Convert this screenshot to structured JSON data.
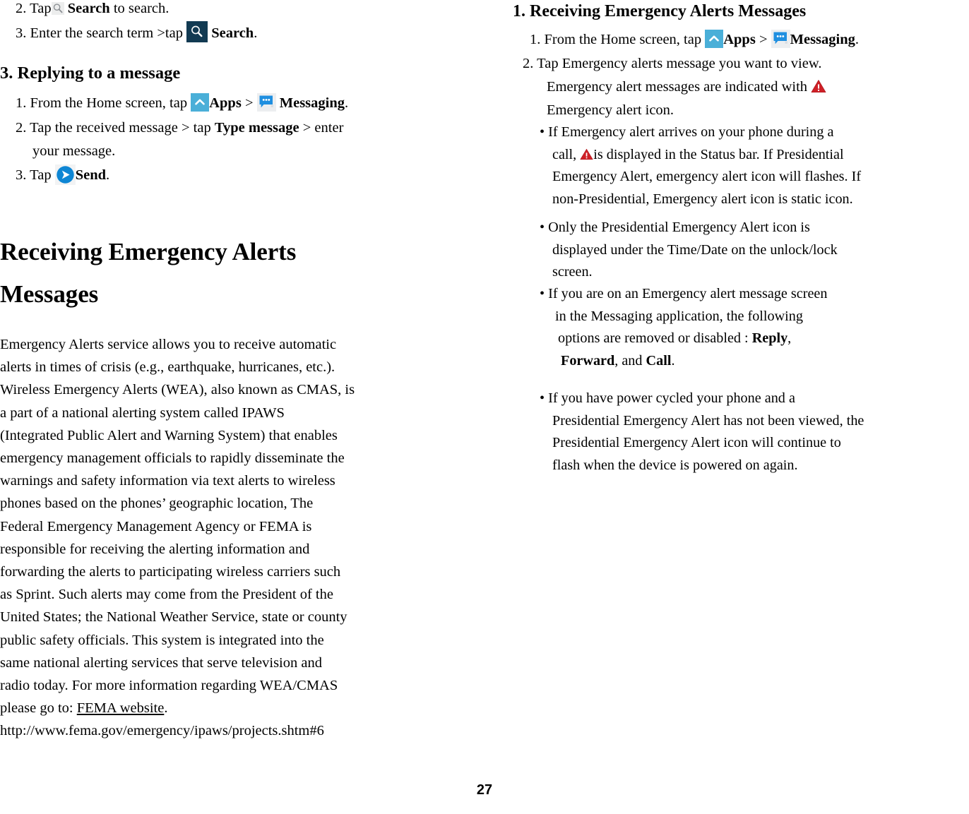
{
  "page": {
    "number": "27"
  },
  "colors": {
    "search_tile_navy": "#123a52",
    "apps_tile_blue": "#4aafd8",
    "messaging_bubble_blue": "#1f8fe0",
    "send_circle_blue": "#0e86d4",
    "warning_red": "#cf2027",
    "icon_tile_gray": "#eceef0"
  },
  "left_column": {
    "searching_steps": [
      {
        "num": "2.",
        "pre": "Tap",
        "icon": "search-icon-gray",
        "bold": "Search",
        "post": "to search."
      },
      {
        "num": "3.",
        "pre": "Enter the search term >tap",
        "icon": "search-icon-navy",
        "bold": "Search",
        "post": "."
      }
    ],
    "replying_heading": "3. Replying to a message",
    "replying_steps": [
      {
        "num": "1.",
        "pre": "From the Home screen, tap",
        "icon1": "apps-icon",
        "bold1": "Apps",
        "mid": ">",
        "icon2": "messaging-icon",
        "bold2": "Messaging",
        "post": "."
      },
      {
        "num": "2.",
        "pre": "Tap the received message > tap",
        "bold1": "Type message",
        "post": "> enter",
        "line2": "your message."
      },
      {
        "num": "3.",
        "pre": "Tap",
        "icon1": "send-icon",
        "bold1": "Send",
        "post": "."
      }
    ],
    "section_title_line1": "Receiving Emergency Alerts",
    "section_title_line2": "Messages",
    "body_lines": [
      "Emergency Alerts service allows you to receive automatic",
      "alerts in times of crisis (e.g., earthquake, hurricanes, etc.).",
      "Wireless Emergency Alerts (WEA), also known as CMAS, is",
      "a part of a national alerting system called IPAWS",
      "(Integrated Public Alert and Warning System) that enables",
      "emergency management officials to rapidly disseminate the",
      "warnings and safety information via text alerts to wireless",
      "phones based on the phones’ geographic location, The",
      "Federal Emergency Management Agency or FEMA is",
      "responsible for receiving the alerting information and",
      "forwarding the alerts to participating wireless carriers such",
      "as Sprint. Such alerts may come from the President of the",
      "United States; the National Weather Service, state or county",
      "public safety officials. This system is integrated into the",
      "same national alerting services that serve television and",
      "radio today. For more information regarding WEA/CMAS"
    ],
    "body_last_prefix": "please go to: ",
    "body_link_text": "FEMA website",
    "body_last_suffix": ".",
    "body_url": "http://www.fema.gov/emergency/ipaws/projects.shtm#6"
  },
  "right_column": {
    "heading": "1. Receiving Emergency Alerts Messages",
    "step1": {
      "num": "1.",
      "pre": "From the Home screen, tap",
      "icon1": "apps-icon",
      "bold1": "Apps",
      "mid": ">",
      "icon2": "messaging-icon",
      "bold2": "Messaging",
      "post": "."
    },
    "step2": {
      "num": "2.",
      "line1": "Tap Emergency alerts message you want to view.",
      "line2_pre": "Emergency alert messages are indicated with",
      "line2_icon": "warning-triangle-icon",
      "line3": "Emergency alert icon."
    },
    "bullets": [
      {
        "line1": "If Emergency alert arrives on your phone during a",
        "line2_pre": "call,",
        "line2_icon": "warning-triangle-icon",
        "line2_post": "is displayed in the Status bar. If Presidential",
        "line3": "Emergency Alert, emergency alert icon will flashes. If",
        "line4": "non-Presidential, Emergency alert icon is static icon."
      },
      {
        "line1": "Only the Presidential Emergency Alert icon is",
        "line2": "displayed under the Time/Date on the unlock/lock",
        "line3": "screen."
      },
      {
        "line1": "If you are on an Emergency alert message screen",
        "line2": "in the Messaging application, the following",
        "line3_pre": "options are removed or disabled : ",
        "line3_bold": "Reply",
        "line3_post": ",",
        "line4_bold1": "Forward",
        "line4_mid": ", and ",
        "line4_bold2": "Call",
        "line4_post": "."
      },
      {
        "line1": "If you have power cycled your phone and a",
        "line2": "Presidential Emergency Alert has not been viewed, the",
        "line3": "Presidential Emergency Alert icon will continue to",
        "line4": "flash when the device is powered on again."
      }
    ]
  }
}
